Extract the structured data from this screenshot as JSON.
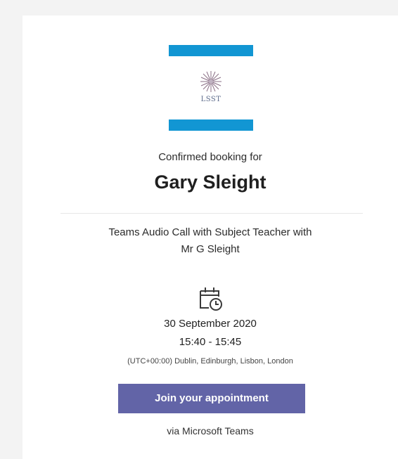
{
  "logo": {
    "text": "LSST"
  },
  "booking": {
    "confirmed_label": "Confirmed booking for",
    "name": "Gary Sleight",
    "description_line1": "Teams Audio Call with Subject Teacher with",
    "description_line2": "Mr G Sleight",
    "date": "30 September 2020",
    "time": "15:40 - 15:45",
    "timezone": "(UTC+00:00) Dublin, Edinburgh, Lisbon, London"
  },
  "actions": {
    "join_label": "Join your appointment",
    "via_label": "via Microsoft Teams"
  },
  "icons": {
    "calendar": "calendar-clock-icon",
    "logo_mark": "star-burst-icon"
  },
  "colors": {
    "logo_bar": "#1296d3",
    "button": "#6264a7",
    "background": "#f3f3f3",
    "card": "#ffffff"
  }
}
